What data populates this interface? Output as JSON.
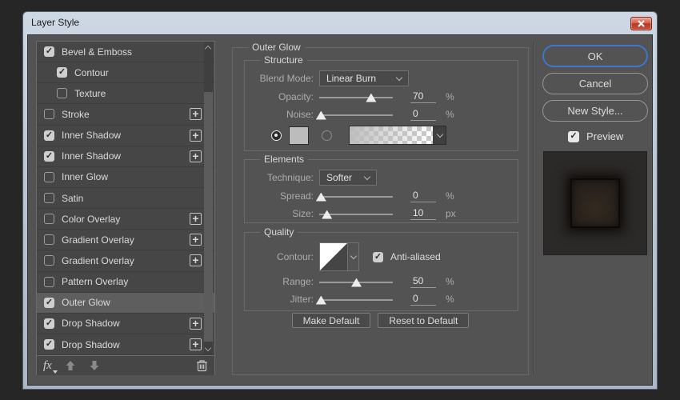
{
  "window": {
    "title": "Layer Style"
  },
  "icons": {
    "check": "✓",
    "plus": "+",
    "close": "close-x",
    "trash": "trash-can",
    "fx": "fx"
  },
  "colors": {
    "dialog_bg": "#535353",
    "list_bg": "#464646",
    "selected_row": "#5e5e5e",
    "accent_ok_border": "#3f76cc",
    "titlebar_top": "#cdd8e4",
    "titlebar_bottom": "#a9b7c7",
    "close_red": "#b93722",
    "swatch_gray": "#bcbcbc"
  },
  "styles_list": {
    "items": [
      {
        "label": "Bevel & Emboss",
        "checked": true,
        "sub": false,
        "plus": false,
        "selected": false
      },
      {
        "label": "Contour",
        "checked": true,
        "sub": true,
        "plus": false,
        "selected": false
      },
      {
        "label": "Texture",
        "checked": false,
        "sub": true,
        "plus": false,
        "selected": false
      },
      {
        "label": "Stroke",
        "checked": false,
        "sub": false,
        "plus": true,
        "selected": false
      },
      {
        "label": "Inner Shadow",
        "checked": true,
        "sub": false,
        "plus": true,
        "selected": false
      },
      {
        "label": "Inner Shadow",
        "checked": true,
        "sub": false,
        "plus": true,
        "selected": false
      },
      {
        "label": "Inner Glow",
        "checked": false,
        "sub": false,
        "plus": false,
        "selected": false
      },
      {
        "label": "Satin",
        "checked": false,
        "sub": false,
        "plus": false,
        "selected": false
      },
      {
        "label": "Color Overlay",
        "checked": false,
        "sub": false,
        "plus": true,
        "selected": false
      },
      {
        "label": "Gradient Overlay",
        "checked": false,
        "sub": false,
        "plus": true,
        "selected": false
      },
      {
        "label": "Gradient Overlay",
        "checked": false,
        "sub": false,
        "plus": true,
        "selected": false
      },
      {
        "label": "Pattern Overlay",
        "checked": false,
        "sub": false,
        "plus": false,
        "selected": false
      },
      {
        "label": "Outer Glow",
        "checked": true,
        "sub": false,
        "plus": false,
        "selected": true
      },
      {
        "label": "Drop Shadow",
        "checked": true,
        "sub": false,
        "plus": true,
        "selected": false
      },
      {
        "label": "Drop Shadow",
        "checked": true,
        "sub": false,
        "plus": true,
        "selected": false
      }
    ],
    "footer": {
      "fx_label": "fx"
    }
  },
  "panel": {
    "title": "Outer Glow",
    "structure": {
      "title": "Structure",
      "blend_mode_label": "Blend Mode:",
      "blend_mode_value": "Linear Burn",
      "opacity_label": "Opacity:",
      "opacity_value": "70",
      "opacity_unit": "%",
      "opacity_pct": 70,
      "noise_label": "Noise:",
      "noise_value": "0",
      "noise_unit": "%",
      "noise_pct": 2,
      "color_selected": true,
      "gradient_selected": false
    },
    "elements": {
      "title": "Elements",
      "technique_label": "Technique:",
      "technique_value": "Softer",
      "spread_label": "Spread:",
      "spread_value": "0",
      "spread_unit": "%",
      "spread_pct": 2,
      "size_label": "Size:",
      "size_value": "10",
      "size_unit": "px",
      "size_pct": 10
    },
    "quality": {
      "title": "Quality",
      "contour_label": "Contour:",
      "antialiased_label": "Anti-aliased",
      "antialiased_checked": true,
      "range_label": "Range:",
      "range_value": "50",
      "range_unit": "%",
      "range_pct": 50,
      "jitter_label": "Jitter:",
      "jitter_value": "0",
      "jitter_unit": "%",
      "jitter_pct": 2
    },
    "buttons": {
      "make_default": "Make Default",
      "reset_to_default": "Reset to Default"
    }
  },
  "actions": {
    "ok": "OK",
    "cancel": "Cancel",
    "new_style": "New Style...",
    "preview_label": "Preview",
    "preview_checked": true
  }
}
